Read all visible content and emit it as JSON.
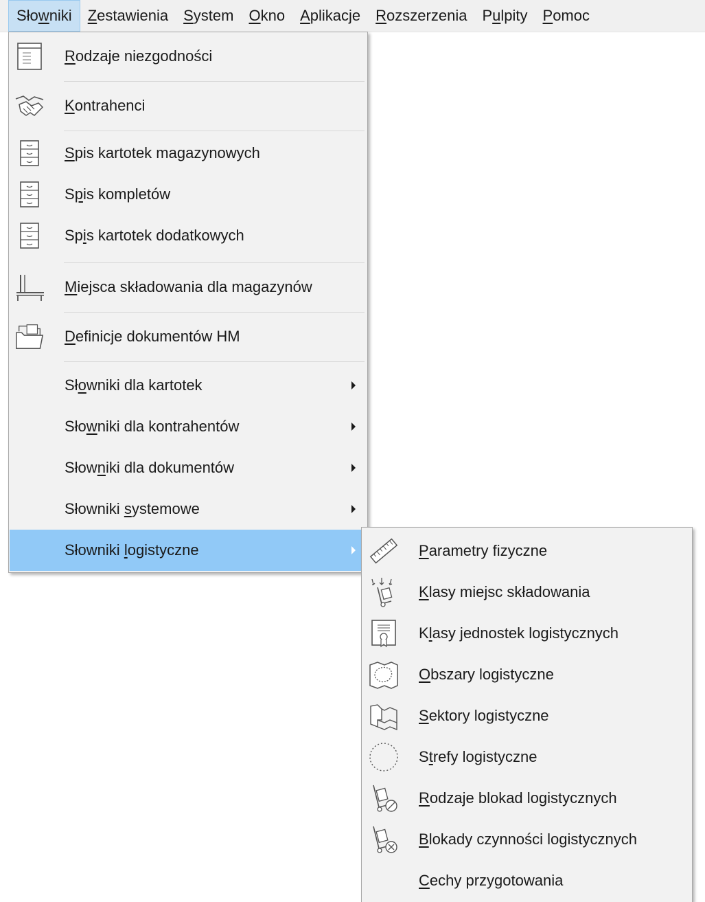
{
  "menubar": [
    {
      "id": "slowniki",
      "pre": "Sło",
      "u": "w",
      "post": "niki",
      "active": true
    },
    {
      "id": "zestawienia",
      "pre": "",
      "u": "Z",
      "post": "estawienia",
      "active": false
    },
    {
      "id": "system",
      "pre": "",
      "u": "S",
      "post": "ystem",
      "active": false
    },
    {
      "id": "okno",
      "pre": "",
      "u": "O",
      "post": "kno",
      "active": false
    },
    {
      "id": "aplikacje",
      "pre": "",
      "u": "A",
      "post": "plikacje",
      "active": false
    },
    {
      "id": "rozszerzenia",
      "pre": "",
      "u": "R",
      "post": "ozszerzenia",
      "active": false
    },
    {
      "id": "pulpity",
      "pre": "P",
      "u": "u",
      "post": "lpity",
      "active": false
    },
    {
      "id": "pomoc",
      "pre": "",
      "u": "P",
      "post": "omoc",
      "active": false
    }
  ],
  "main_menu": [
    {
      "id": "rodzaje-niezgodnosci",
      "pre": "",
      "u": "R",
      "post": "odzaje niezgodności",
      "icon": "list-icon"
    },
    {
      "id": "kontrahenci",
      "pre": "",
      "u": "K",
      "post": "ontrahenci",
      "icon": "handshake-icon"
    },
    {
      "id": "spis-kartotek-magazynowych",
      "pre": "",
      "u": "S",
      "post": "pis kartotek magazynowych",
      "icon": "file-cabinet-icon"
    },
    {
      "id": "spis-kompletow",
      "pre": "S",
      "u": "p",
      "post": "is kompletów",
      "icon": "file-cabinet-icon"
    },
    {
      "id": "spis-kartotek-dodatkowych",
      "pre": "Sp",
      "u": "i",
      "post": "s kartotek dodatkowych",
      "icon": "file-cabinet-icon"
    },
    {
      "id": "miejsca-skladowania",
      "pre": "",
      "u": "M",
      "post": "iejsca składowania dla magazynów",
      "icon": "shelf-icon"
    },
    {
      "id": "definicje-dokumentow-hm",
      "pre": "",
      "u": "D",
      "post": "efinicje dokumentów HM",
      "icon": "folder-icon"
    },
    {
      "id": "slowniki-dla-kartotek",
      "pre": "Sł",
      "u": "o",
      "post": "wniki dla kartotek",
      "submenu": true
    },
    {
      "id": "slowniki-dla-kontrahentow",
      "pre": "Sło",
      "u": "w",
      "post": "niki dla kontrahentów",
      "submenu": true
    },
    {
      "id": "slowniki-dla-dokumentow",
      "pre": "Słow",
      "u": "n",
      "post": "iki dla dokumentów",
      "submenu": true
    },
    {
      "id": "slowniki-systemowe",
      "pre": "Słowniki ",
      "u": "s",
      "post": "ystemowe",
      "submenu": true
    },
    {
      "id": "slowniki-logistyczne",
      "pre": "Słowniki ",
      "u": "l",
      "post": "ogistyczne",
      "submenu": true,
      "highlighted": true
    }
  ],
  "sub_menu": [
    {
      "id": "parametry-fizyczne",
      "pre": "",
      "u": "P",
      "post": "arametry fizyczne",
      "icon": "ruler-icon"
    },
    {
      "id": "klasy-miejsc-skladowania",
      "pre": "",
      "u": "K",
      "post": "lasy miejsc składowania",
      "icon": "hand-truck-arrows-icon"
    },
    {
      "id": "klasy-jednostek-logistycznych",
      "pre": "K",
      "u": "l",
      "post": "asy jednostek logistycznych",
      "icon": "certificate-icon"
    },
    {
      "id": "obszary-logistyczne",
      "pre": "",
      "u": "O",
      "post": "bszary logistyczne",
      "icon": "map-area-icon"
    },
    {
      "id": "sektory-logistyczne",
      "pre": "",
      "u": "S",
      "post": "ektory logistyczne",
      "icon": "map-sector-icon"
    },
    {
      "id": "strefy-logistyczne",
      "pre": "S",
      "u": "t",
      "post": "refy logistyczne",
      "icon": "dotted-circle-icon"
    },
    {
      "id": "rodzaje-blokad-logistycznych",
      "pre": "",
      "u": "R",
      "post": "odzaje blokad logistycznych",
      "icon": "hand-truck-block-icon"
    },
    {
      "id": "blokady-czynnosci-logistycznych",
      "pre": "",
      "u": "B",
      "post": "lokady czynności logistycznych",
      "icon": "hand-truck-cancel-icon"
    },
    {
      "id": "cechy-przygotowania",
      "pre": "",
      "u": "C",
      "post": "echy przygotowania",
      "icon": ""
    }
  ],
  "colors": {
    "highlight": "#91c9f7",
    "menubar_active": "#c7e0f4",
    "menu_bg": "#f2f2f2"
  }
}
